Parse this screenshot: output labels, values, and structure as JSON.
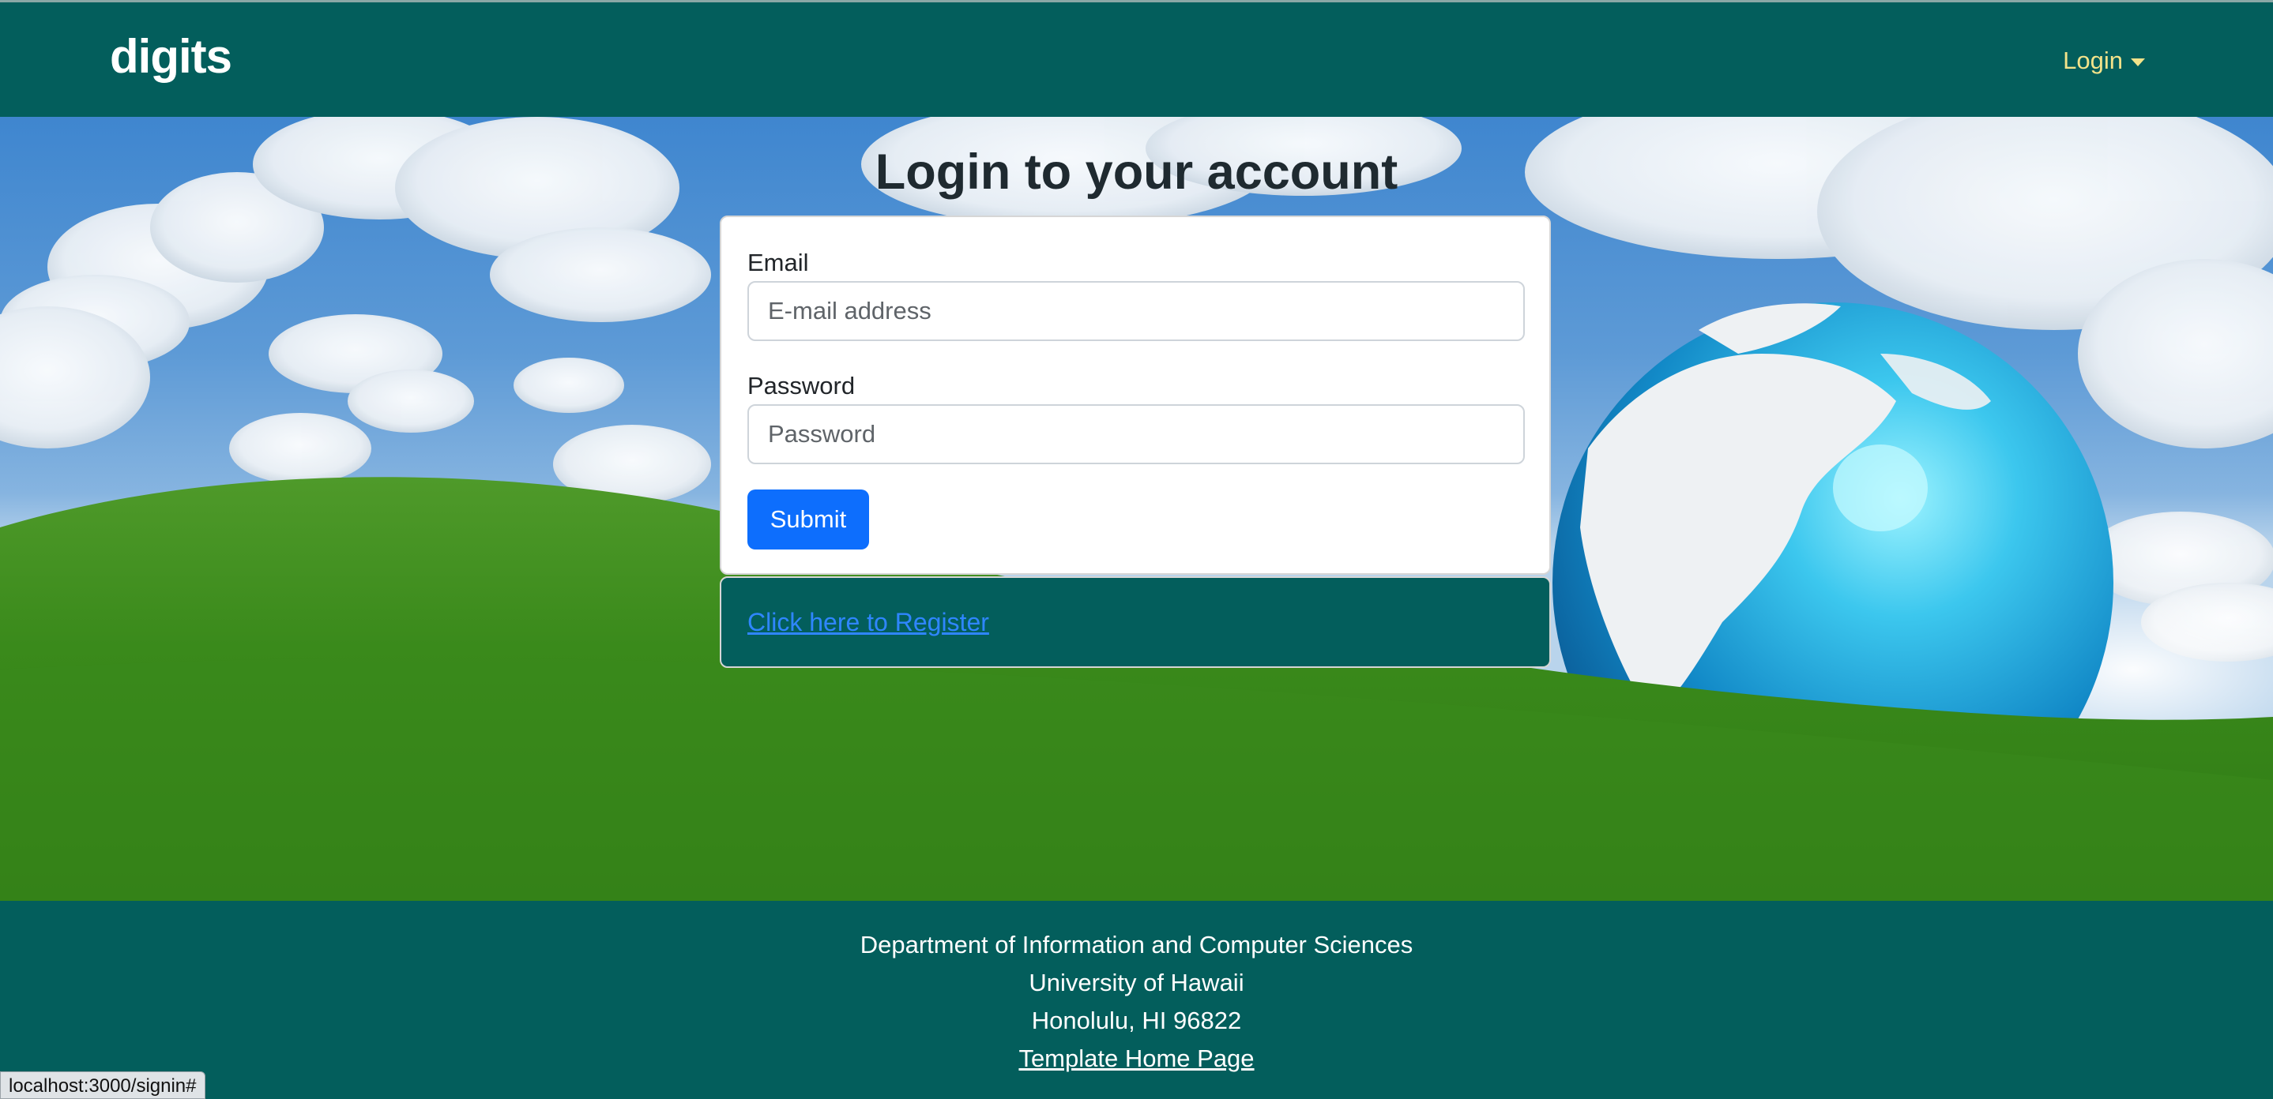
{
  "navbar": {
    "brand": "digits",
    "login_menu": "Login"
  },
  "page": {
    "title": "Login to your account"
  },
  "form": {
    "email_label": "Email",
    "email_placeholder": "E-mail address",
    "email_value": "",
    "password_label": "Password",
    "password_placeholder": "Password",
    "password_value": "",
    "submit_label": "Submit"
  },
  "register": {
    "link_text": "Click here to Register"
  },
  "footer": {
    "line1": "Department of Information and Computer Sciences",
    "line2": "University of Hawaii",
    "line3": "Honolulu, HI 96822",
    "link": "Template Home Page"
  },
  "status_bar": {
    "url": "localhost:3000/signin#"
  },
  "colors": {
    "theme": "#035e5c",
    "nav_link": "#f3e38a",
    "primary_button": "#0d6efd",
    "link": "#2f86ff"
  }
}
